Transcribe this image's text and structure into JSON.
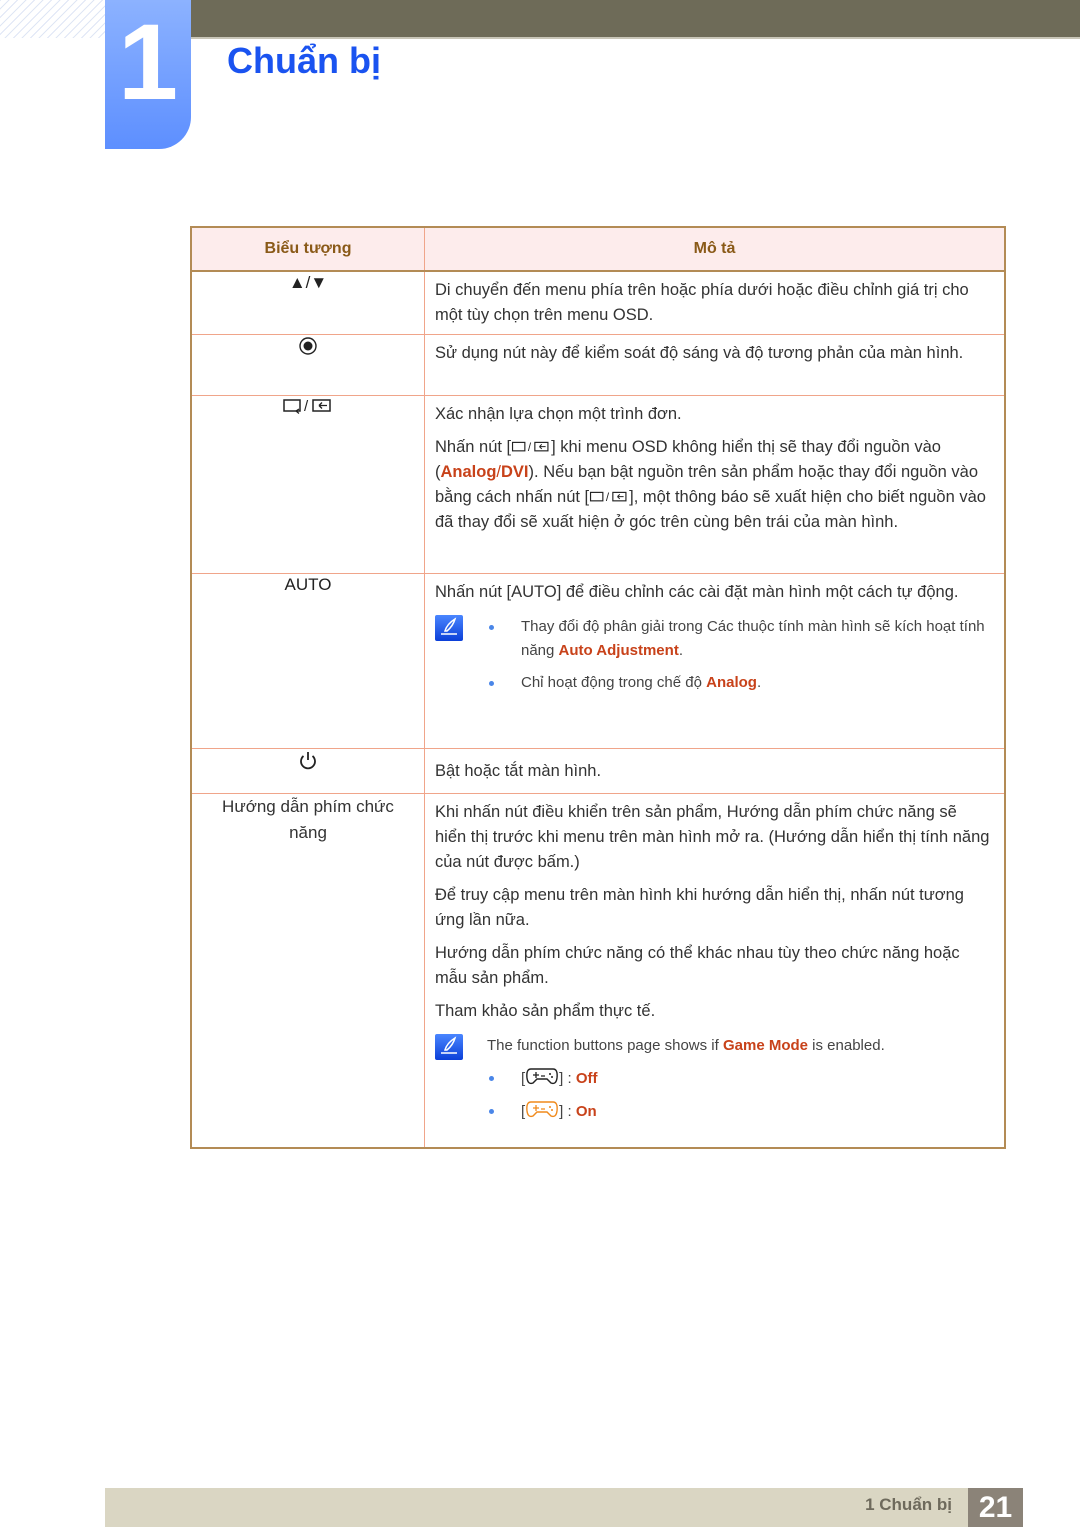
{
  "chapter": {
    "number": "1",
    "title": "Chuẩn bị"
  },
  "table": {
    "headers": {
      "icon": "Biểu tượng",
      "description": "Mô tả"
    },
    "rows": [
      {
        "icon": "up-down-arrows",
        "symbol": "▲/▼",
        "text": "Di chuyển đến menu phía trên hoặc phía dưới hoặc điều chỉnh giá trị cho một tùy chọn trên menu OSD."
      },
      {
        "icon": "brightness-button",
        "symbol": "◉",
        "text": "Sử dụng nút này để kiểm soát độ sáng và độ tương phản của màn hình."
      },
      {
        "icon": "source-enter",
        "p1": "Xác nhận lựa chọn một trình đơn.",
        "p2_a": "Nhấn nút [",
        "p2_b": "] khi menu OSD không hiển thị sẽ thay đổi nguồn vào (",
        "p2_hl1": "Analog",
        "p2_slash": "/",
        "p2_hl2": "DVI",
        "p2_c": "). Nếu bạn bật nguồn trên sản phẩm hoặc thay đổi nguồn vào bằng cách nhấn nút [",
        "p2_d": "], một thông báo sẽ xuất hiện cho biết nguồn vào đã thay đổi sẽ xuất hiện ở góc trên cùng bên trái của màn hình."
      },
      {
        "icon": "auto",
        "symbol": "AUTO",
        "p1_a": "Nhấn nút [",
        "p1_key": "AUTO",
        "p1_b": "] để điều chỉnh các cài đặt màn hình một cách tự động.",
        "notes": [
          {
            "a": "Thay đổi độ phân giải trong Các thuộc tính màn hình sẽ kích hoạt tính năng ",
            "hl": "Auto Adjustment",
            "b": "."
          },
          {
            "a": "Chỉ hoạt động trong chế độ ",
            "hl": "Analog",
            "b": "."
          }
        ]
      },
      {
        "icon": "power",
        "text": "Bật hoặc tắt màn hình."
      },
      {
        "icon": "function-key-guide",
        "symbol": "Hướng dẫn phím chức năng",
        "paragraphs": [
          "Khi nhấn nút điều khiển trên sản phẩm, Hướng dẫn phím chức năng sẽ hiển thị trước khi menu trên màn hình mở ra. (Hướng dẫn hiển thị tính năng của nút được bấm.)",
          "Để truy cập menu trên màn hình khi hướng dẫn hiển thị, nhấn nút tương ứng lần nữa.",
          "Hướng dẫn phím chức năng có thể khác nhau tùy theo chức năng hoặc mẫu sản phẩm.",
          "Tham khảo sản phẩm thực tế."
        ],
        "note_intro_a": "The function buttons page shows if ",
        "note_intro_hl": "Game Mode",
        "note_intro_b": " is enabled.",
        "game_items": [
          {
            "state": "Off",
            "icon_color": "#222222"
          },
          {
            "state": "On",
            "icon_color": "#f08a1c"
          }
        ]
      }
    ]
  },
  "footer": {
    "label": "1 Chuẩn bị",
    "page": "21"
  },
  "colors": {
    "accent": "#c8421a",
    "title_blue": "#1a53f0",
    "header_text": "#8a5a18"
  }
}
